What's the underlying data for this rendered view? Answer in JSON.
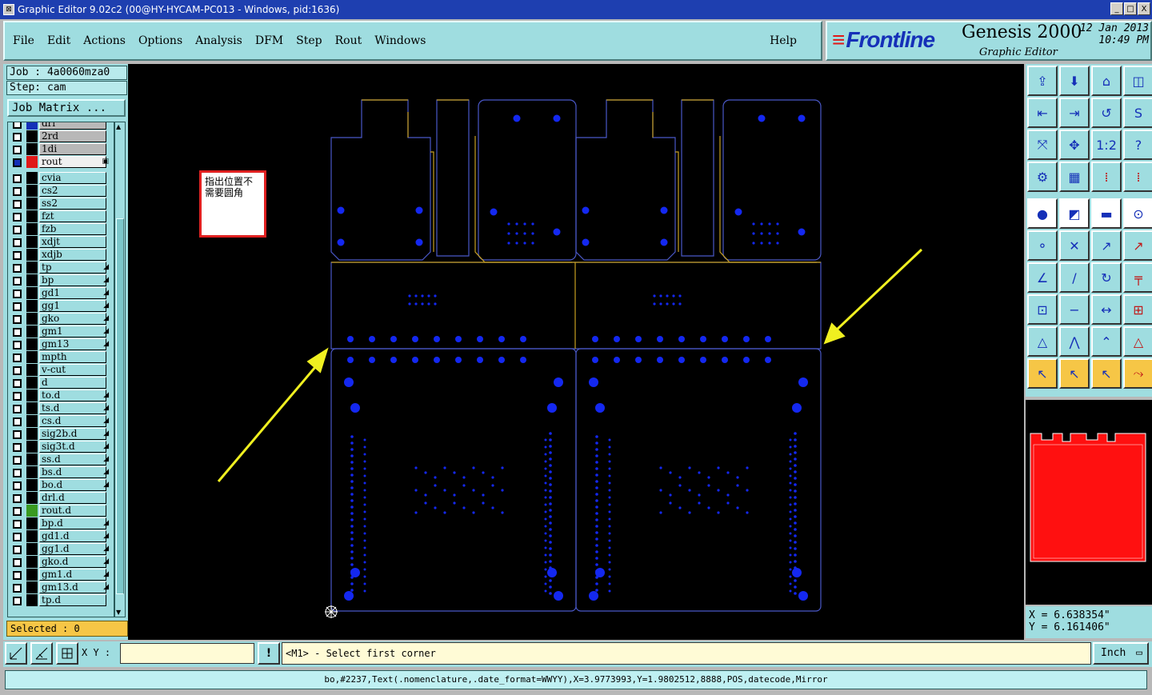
{
  "window": {
    "title": "Graphic Editor 9.02c2 (00@HY-HYCAM-PC013 - Windows, pid:1636)",
    "controls": [
      "_",
      "□",
      "X"
    ]
  },
  "menu": {
    "items": [
      "File",
      "Edit",
      "Actions",
      "Options",
      "Analysis",
      "DFM",
      "Step",
      "Rout",
      "Windows"
    ],
    "help": "Help"
  },
  "brand": {
    "logo": "Frontline",
    "product": "Genesis 2000",
    "subtitle": "Graphic Editor",
    "date": "12 Jan 2013",
    "time": "10:49 PM"
  },
  "job": {
    "job_label": "Job : 4a0060mza0",
    "step_label": "Step: cam",
    "matrix_button": "Job Matrix ..."
  },
  "layers": [
    {
      "name": "drl",
      "color": "#1530b8",
      "bg": "#b8b8b8"
    },
    {
      "name": "2rd",
      "color": "#000000",
      "bg": "#b8b8b8"
    },
    {
      "name": "1di",
      "color": "#000000",
      "bg": "#b8b8b8"
    },
    {
      "name": "rout",
      "color": "#e01818",
      "bg": "#f0f0f0",
      "active": true
    },
    {
      "name": "cvia",
      "color": "#000000"
    },
    {
      "name": "cs2",
      "color": "#000000"
    },
    {
      "name": "ss2",
      "color": "#000000"
    },
    {
      "name": "fzt",
      "color": "#000000"
    },
    {
      "name": "fzb",
      "color": "#000000"
    },
    {
      "name": "xdjt",
      "color": "#000000"
    },
    {
      "name": "xdjb",
      "color": "#000000"
    },
    {
      "name": "tp",
      "color": "#000000",
      "arrow": true
    },
    {
      "name": "bp",
      "color": "#000000",
      "arrow": true
    },
    {
      "name": "gd1",
      "color": "#000000",
      "arrow": true
    },
    {
      "name": "gg1",
      "color": "#000000",
      "arrow": true
    },
    {
      "name": "gko",
      "color": "#000000",
      "arrow": true
    },
    {
      "name": "gm1",
      "color": "#000000",
      "arrow": true
    },
    {
      "name": "gm13",
      "color": "#000000",
      "arrow": true
    },
    {
      "name": "mpth",
      "color": "#000000"
    },
    {
      "name": "v-cut",
      "color": "#000000"
    },
    {
      "name": "d",
      "color": "#000000"
    },
    {
      "name": "to.d",
      "color": "#000000",
      "arrow": true
    },
    {
      "name": "ts.d",
      "color": "#000000",
      "arrow": true
    },
    {
      "name": "cs.d",
      "color": "#000000",
      "arrow": true
    },
    {
      "name": "sig2b.d",
      "color": "#000000",
      "arrow": true
    },
    {
      "name": "sig3t.d",
      "color": "#000000",
      "arrow": true
    },
    {
      "name": "ss.d",
      "color": "#000000",
      "arrow": true
    },
    {
      "name": "bs.d",
      "color": "#000000",
      "arrow": true
    },
    {
      "name": "bo.d",
      "color": "#000000",
      "arrow": true
    },
    {
      "name": "drl.d",
      "color": "#000000"
    },
    {
      "name": "rout.d",
      "color": "#3a9a20"
    },
    {
      "name": "bp.d",
      "color": "#000000",
      "arrow": true
    },
    {
      "name": "gd1.d",
      "color": "#000000",
      "arrow": true
    },
    {
      "name": "gg1.d",
      "color": "#000000",
      "arrow": true
    },
    {
      "name": "gko.d",
      "color": "#000000",
      "arrow": true
    },
    {
      "name": "gm1.d",
      "color": "#000000",
      "arrow": true
    },
    {
      "name": "gm13.d",
      "color": "#000000",
      "arrow": true
    },
    {
      "name": "tp.d",
      "color": "#000000"
    }
  ],
  "selection": {
    "label": "Selected : 0"
  },
  "note": {
    "text": "指出位置不需要圆角"
  },
  "coords": {
    "x": "X  =  6.638354\"",
    "y": "Y  =  6.161406\""
  },
  "input": {
    "label": "X Y :",
    "value": ""
  },
  "prompt": {
    "text": "<M1> - Select first corner"
  },
  "units": {
    "label": "Inch"
  },
  "status": {
    "text": "bo,#2237,Text(.nomenclature,.date_format=WWYY),X=3.9773993,Y=1.9802512,8888,POS,datecode,Mirror"
  },
  "colors": {
    "board_outline": "#4a58c8",
    "pads": "#1428f0",
    "rout_path": "#c8a020",
    "arrow": "#f0f020",
    "preview_fill": "#ff1010"
  },
  "toolbar_icons": [
    "home-icon",
    "save-icon",
    "step-icon",
    "window-icon",
    "fit-icon",
    "next-icon",
    "undo-icon",
    "split-icon",
    "zoom-fit-icon",
    "pan-icon",
    "scale-icon",
    "help-icon",
    "settings-icon",
    "grid-icon",
    "layer-red-icon",
    "layer-red2-icon",
    "pad-icon",
    "edit-icon",
    "measure-icon",
    "circle-icon",
    "connect-icon",
    "cross-icon",
    "move-icon",
    "rotate-icon",
    "line-icon",
    "slash-icon",
    "arc-icon",
    "text-icon",
    "copy-icon",
    "minus-icon",
    "resize-icon",
    "group-icon",
    "arrow-tri-icon",
    "polygon-icon",
    "chevron-icon",
    "triangle-icon",
    "select-icon",
    "select2-icon",
    "select3-icon",
    "route-icon"
  ]
}
